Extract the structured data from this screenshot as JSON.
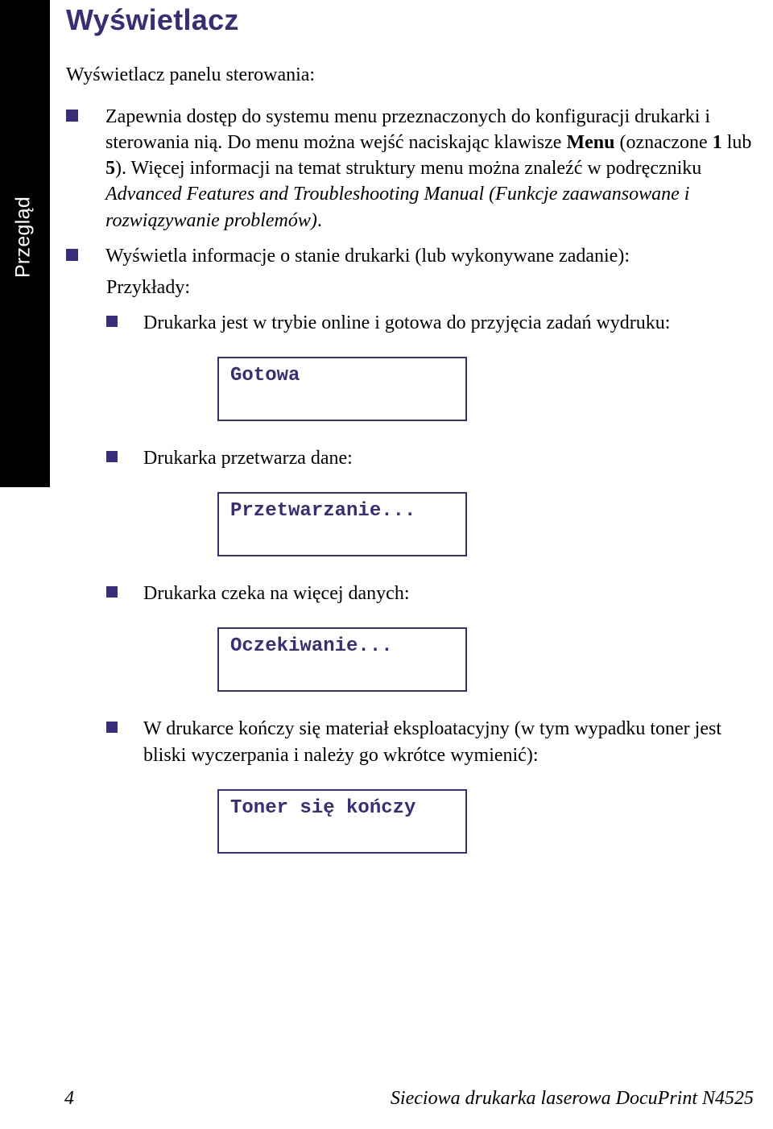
{
  "tab": "Przegląd",
  "heading": "Wyświetlacz",
  "intro": "Wyświetlacz panelu sterowania:",
  "bullets": {
    "b1_pre": "Zapewnia dostęp do systemu menu przeznaczonych do konfiguracji drukarki i sterowania nią. Do menu można wejść naciskając klawisze ",
    "b1_bold1": "Menu",
    "b1_mid": " (oznaczone ",
    "b1_bold2": "1",
    "b1_mid2": " lub ",
    "b1_bold3": "5",
    "b1_mid3": "). Więcej informacji na temat struktury menu można znaleźć w podręczniku ",
    "b1_italic": "Advanced Features and Troubleshooting Manual (Funkcje zaawansowane i rozwiązywanie problemów)",
    "b1_post": ".",
    "b2": "Wyświetla informacje o stanie drukarki (lub wykonywane zadanie):"
  },
  "examples_label": "Przykłady:",
  "examples": {
    "e1_text": "Drukarka jest w trybie online i gotowa do przyjęcia zadań wydruku:",
    "e1_display": "Gotowa",
    "e2_text": "Drukarka przetwarza dane:",
    "e2_display": "Przetwarzanie...",
    "e3_text": "Drukarka czeka na więcej danych:",
    "e3_display": "Oczekiwanie...",
    "e4_text": "W drukarce kończy się materiał eksploatacyjny (w tym wypadku toner jest bliski wyczerpania i należy go wkrótce wymienić):",
    "e4_display": "Toner się kończy"
  },
  "footer": {
    "page": "4",
    "title": "Sieciowa drukarka laserowa DocuPrint N4525"
  }
}
